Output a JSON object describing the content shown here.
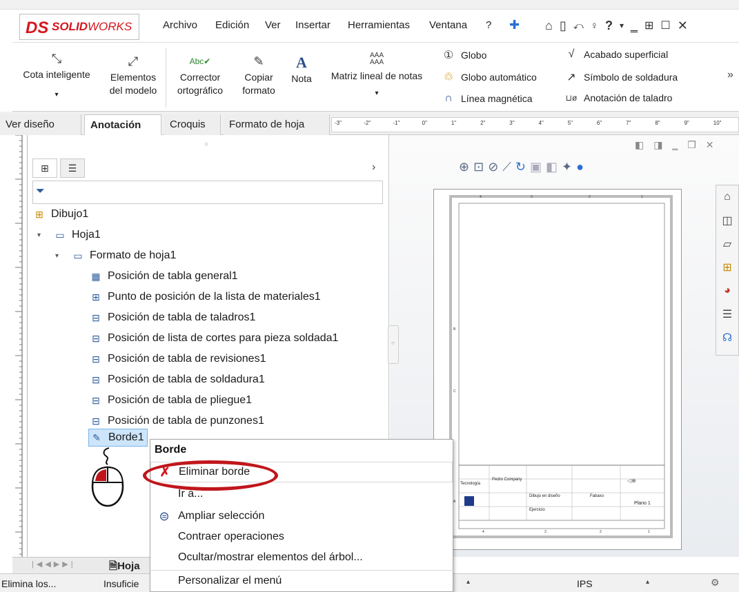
{
  "app": {
    "brand": "SOLIDWORKS",
    "brand_prefix": "SOLID",
    "brand_suffix": "WORKS"
  },
  "menu": {
    "items": [
      "Archivo",
      "Edición",
      "Ver",
      "Insertar",
      "Herramientas",
      "Ventana",
      "?"
    ]
  },
  "quickbar": {
    "icons": [
      "pin-icon",
      "home-icon",
      "new-file-icon",
      "undo-icon",
      "user-icon",
      "help-icon",
      "minimize-icon",
      "restore-icon",
      "maximize-icon",
      "close-icon"
    ]
  },
  "ribbon": {
    "cota": "Cota inteligente",
    "elementos_l1": "Elementos",
    "elementos_l2": "del modelo",
    "corrector_l1": "Corrector",
    "corrector_l2": "ortográfico",
    "copiar_l1": "Copiar",
    "copiar_l2": "formato",
    "nota": "Nota",
    "nota_icon": "A",
    "matriz": "Matriz lineal de notas",
    "globo": "Globo",
    "globo_auto": "Globo automático",
    "linea_magnetica": "Línea magnética",
    "acabado": "Acabado superficial",
    "simbolo_soldadura": "Símbolo de soldadura",
    "anotacion_taladro": "Anotación de taladro",
    "more": "»"
  },
  "tabs": [
    "Ver diseño",
    "Anotación",
    "Croquis",
    "Formato de hoja"
  ],
  "active_tab": "Anotación",
  "tree": {
    "root": "Dibujo1",
    "sheet": "Hoja1",
    "format": "Formato de hoja1",
    "items": [
      "Posición de tabla general1",
      "Punto de posición de la lista de materiales1",
      "Posición de tabla de taladros1",
      "Posición de lista de cortes para pieza soldada1",
      "Posición de tabla de revisiones1",
      "Posición de tabla de soldadura1",
      "Posición de tabla de pliegue1",
      "Posición de tabla de punzones1"
    ],
    "selected": "Borde1"
  },
  "context_menu": {
    "title": "Borde",
    "items": [
      {
        "label": "Eliminar borde",
        "icon": "delete-x-icon"
      },
      {
        "label": "Ir a...",
        "icon": ""
      },
      {
        "label": "Ampliar selección",
        "icon": "zoom-icon"
      },
      {
        "label": "Contraer operaciones",
        "icon": ""
      },
      {
        "label": "Ocultar/mostrar elementos del árbol...",
        "icon": ""
      },
      {
        "label": "Personalizar el menú",
        "icon": ""
      }
    ]
  },
  "sheet_tab": "Hoja",
  "status": {
    "left": "Elimina los...",
    "second": "Insuficie",
    "units": "IPS"
  },
  "ruler": {
    "h_labels": [
      "-3\"",
      "-2\"",
      "-1\"",
      "0\"",
      "1\"",
      "2\"",
      "3\"",
      "4\"",
      "5\"",
      "6\"",
      "7\"",
      "8\"",
      "9\"",
      "10\""
    ]
  },
  "drawing": {
    "col_labels_top": [
      "4",
      "3",
      "2",
      "1"
    ],
    "row_labels_left": [
      "B",
      "C",
      "A"
    ],
    "title_block": [
      "Tecnología",
      "Pedro Company",
      "Dibujo en diseño",
      "Ejercicio",
      "Plano 1",
      "Fabaxo"
    ]
  },
  "colors": {
    "brand_red": "#d5161e",
    "highlight": "#c0161b",
    "tab_active_bg": "#ffffff",
    "selection": "#cde5fb"
  }
}
